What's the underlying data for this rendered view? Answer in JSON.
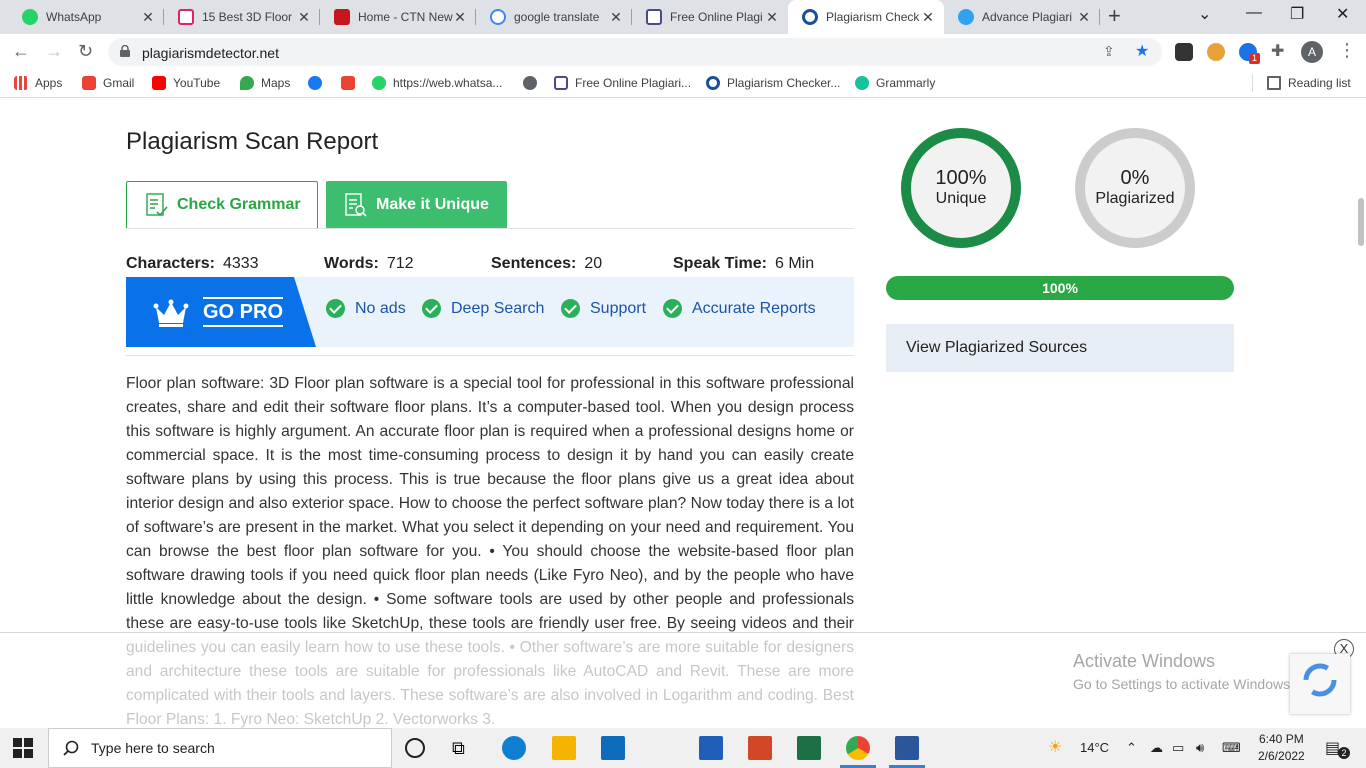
{
  "browser": {
    "tabs": [
      {
        "title": "WhatsApp",
        "color": "#25d366"
      },
      {
        "title": "15 Best 3D Floor",
        "color": "#e0245e"
      },
      {
        "title": "Home - CTN New",
        "color": "#c4161c"
      },
      {
        "title": "google translate",
        "color": "#4285f4"
      },
      {
        "title": "Free Online Plagi",
        "color": "#4a4a8a"
      },
      {
        "title": "Plagiarism Check",
        "color": "#1a4f9c"
      },
      {
        "title": "Advance Plagiari",
        "color": "#2ea3f2"
      }
    ],
    "new_tab": "+",
    "url": "plagiarismdetector.net",
    "bookmarks": [
      {
        "label": "Apps",
        "color": "#e8453c"
      },
      {
        "label": "Gmail",
        "color": "#ea4335"
      },
      {
        "label": "YouTube",
        "color": "#ff0000"
      },
      {
        "label": "Maps",
        "color": "#34a853"
      },
      {
        "label": "",
        "color": "#1877f2"
      },
      {
        "label": "",
        "color": "#ea4335"
      },
      {
        "label": "https://web.whatsa...",
        "color": "#25d366"
      },
      {
        "label": "",
        "color": "#5f6368"
      },
      {
        "label": "Free Online Plagiari...",
        "color": "#4a4a8a"
      },
      {
        "label": "Plagiarism Checker...",
        "color": "#1a4f9c"
      },
      {
        "label": "Grammarly",
        "color": "#15c39a"
      }
    ],
    "reading_list": "Reading list",
    "profile_initial": "A",
    "ext_badge": "1"
  },
  "report": {
    "title": "Plagiarism Scan Report",
    "check_grammar": "Check Grammar",
    "make_unique": "Make it Unique",
    "stats": {
      "characters_label": "Characters:",
      "characters": "4333",
      "words_label": "Words:",
      "words": "712",
      "sentences_label": "Sentences:",
      "sentences": "20",
      "speak_label": "Speak Time:",
      "speak": "6 Min"
    },
    "gopro": {
      "label": "GO PRO",
      "features": [
        "No ads",
        "Deep Search",
        "Support",
        "Accurate Reports"
      ]
    },
    "text": "Floor plan software: 3D Floor plan software is a special tool for professional in this software professional creates, share and edit their software floor plans. It’s a computer-based tool. When you design process this software is highly argument. An accurate floor plan is required when a professional designs home or commercial space. It is the most time-consuming process to design it by hand you can easily create software plans by using this process. This is true because the floor plans give us a great idea about interior design and also exterior space. How to choose the perfect software plan? Now today there is a lot of software’s are present in the market. What you select it depending on your need and requirement. You can browse the best floor plan software for you. • You should choose the website-based floor plan software drawing tools if you need quick floor plan needs (Like Fyro Neo), and by the people who have little knowledge about the design. • Some software tools are used by other people and professionals these are easy-to-use tools like SketchUp, these tools are friendly user free. By seeing videos and their guidelines you can easily learn how to use these tools. • Other software’s are more suitable for designers and architecture these tools are suitable for professionals like AutoCAD and Revit. These are more complicated with their tools and layers. These software’s are also involved in Logarithm and coding. Best Floor Plans: 1. Fyro Neo: SketchUp 2. Vectorworks 3."
  },
  "results": {
    "unique_pct": "100%",
    "unique_label": "Unique",
    "unique_color": "#1c8b45",
    "plag_pct": "0%",
    "plag_label": "Plagiarized",
    "plag_color": "#cccccc",
    "progress_label": "100%",
    "progress": 1.0,
    "view_sources": "View Plagiarized Sources"
  },
  "overlay": {
    "close": "X",
    "activate_title": "Activate Windows",
    "activate_sub": "Go to Settings to activate Windows."
  },
  "taskbar": {
    "search_placeholder": "Type here to search",
    "temperature": "14°C",
    "time": "6:40 PM",
    "date": "2/6/2022",
    "notification_count": "2"
  }
}
